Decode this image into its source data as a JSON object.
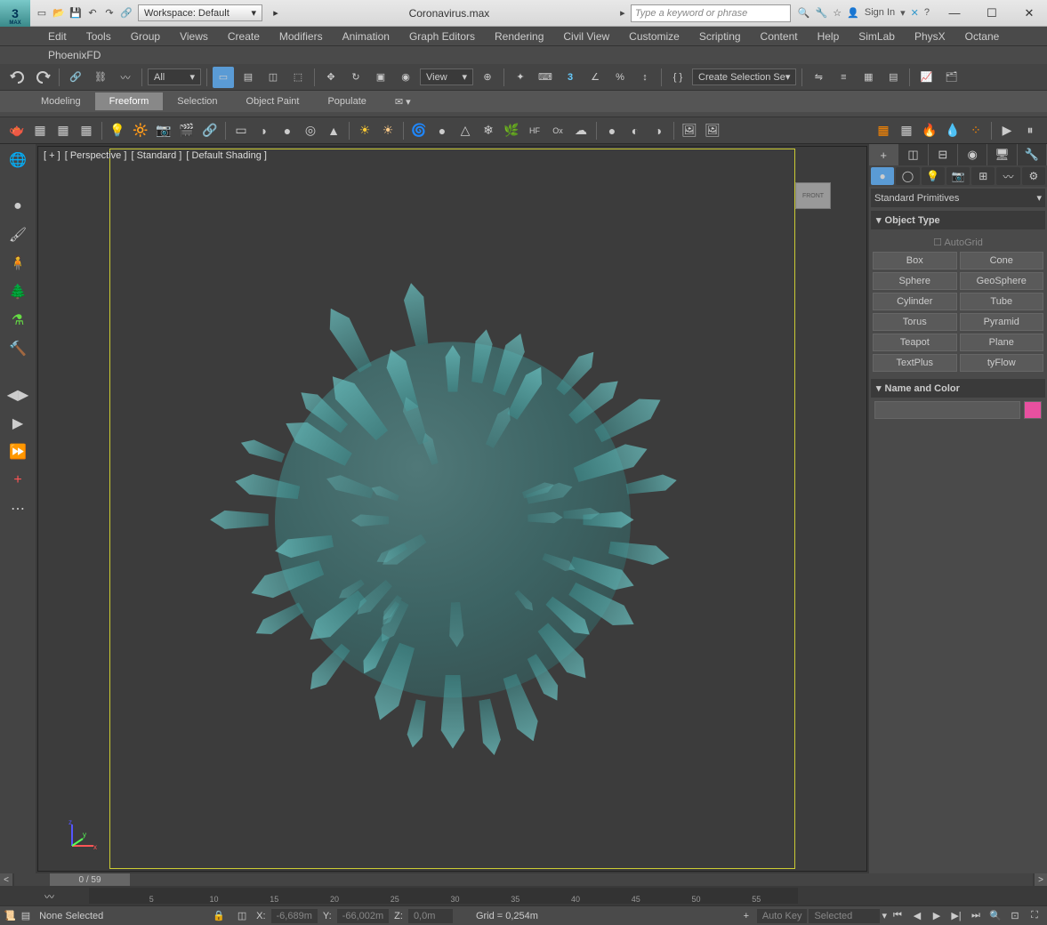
{
  "title": {
    "file": "Coronavirus.max",
    "workspace": "Workspace: Default",
    "search_ph": "Type a keyword or phrase",
    "signin": "Sign In"
  },
  "menu": [
    "Edit",
    "Tools",
    "Group",
    "Views",
    "Create",
    "Modifiers",
    "Animation",
    "Graph Editors",
    "Rendering",
    "Civil View",
    "Customize",
    "Scripting",
    "Content",
    "Help",
    "SimLab",
    "PhysX",
    "Octane"
  ],
  "menu2": "PhoenixFD",
  "maintb": {
    "filter": "All",
    "view": "View",
    "selset": "Create Selection Se"
  },
  "ribbon": {
    "tabs": [
      "Modeling",
      "Freeform",
      "Selection",
      "Object Paint",
      "Populate"
    ],
    "active": 1
  },
  "viewport": {
    "label_parts": [
      "[ + ]",
      "[ Perspective ]",
      "[ Standard ]",
      "[ Default Shading ]"
    ],
    "cube": "FRONT"
  },
  "cmd": {
    "category": "Standard Primitives",
    "rollout1": "Object Type",
    "autogrid": "AutoGrid",
    "objects": [
      "Box",
      "Cone",
      "Sphere",
      "GeoSphere",
      "Cylinder",
      "Tube",
      "Torus",
      "Pyramid",
      "Teapot",
      "Plane",
      "TextPlus",
      "tyFlow"
    ],
    "rollout2": "Name and Color",
    "color": "#e850a0"
  },
  "time": {
    "frame": "0 / 59",
    "ticks": [
      "5",
      "10",
      "15",
      "20",
      "25",
      "30",
      "35",
      "40",
      "45",
      "50",
      "55"
    ]
  },
  "status": {
    "selection": "None Selected",
    "x": "-6,689m",
    "y": "-66,002m",
    "z": "0,0m",
    "grid": "Grid = 0,254m",
    "autokey": "Auto Key",
    "selected": "Selected"
  }
}
